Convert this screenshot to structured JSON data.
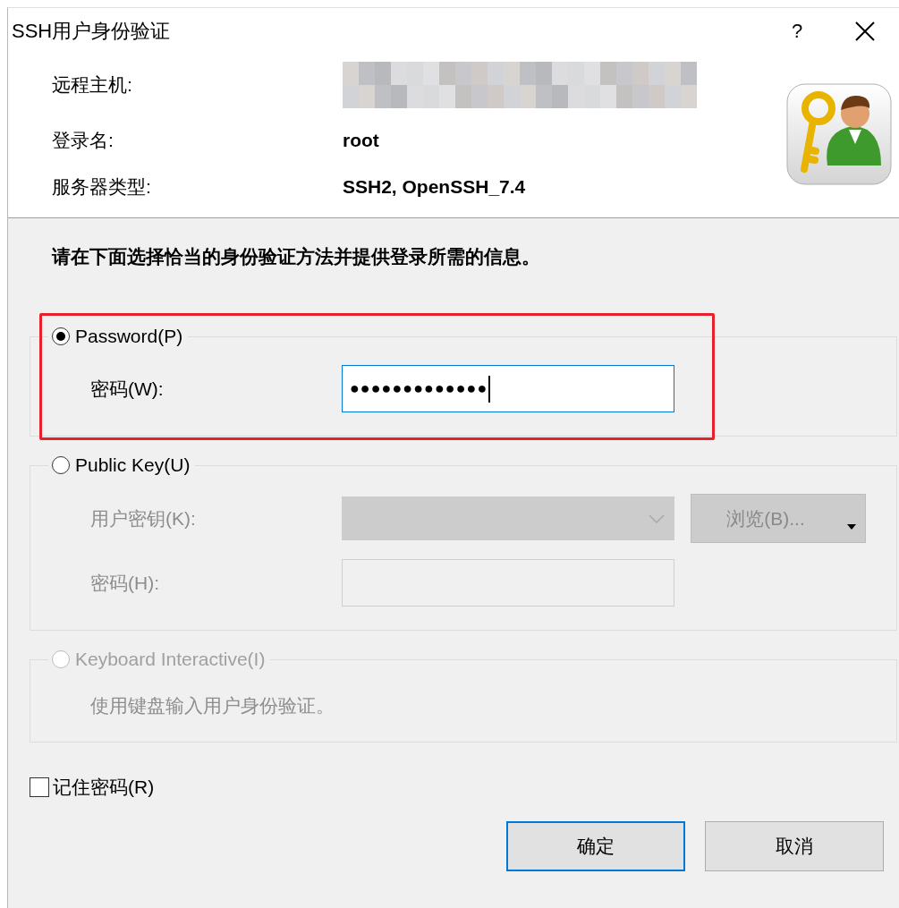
{
  "window": {
    "title": "SSH用户身份验证",
    "help": "?"
  },
  "info": [
    {
      "label": "远程主机:",
      "kind": "redacted"
    },
    {
      "label": "登录名:",
      "kind": "text",
      "value": "root"
    },
    {
      "label": "服务器类型:",
      "kind": "text",
      "value": "SSH2, OpenSSH_7.4"
    }
  ],
  "instruction": "请在下面选择恰当的身份验证方法并提供登录所需的信息。",
  "methods": [
    {
      "label": "Password(P)",
      "selected": true,
      "disabled": false,
      "highlighted": true,
      "fields": [
        {
          "kind": "text",
          "label": "密码(W):",
          "value": "●●●●●●●●●●●●●",
          "focused": true,
          "disabled": false
        }
      ]
    },
    {
      "label": "Public Key(U)",
      "selected": false,
      "disabled": false,
      "highlighted": false,
      "fields": [
        {
          "kind": "combo",
          "label": "用户密钥(K):",
          "disabled": true,
          "button": "浏览(B)..."
        },
        {
          "kind": "text",
          "label": "密码(H):",
          "disabled": true,
          "focused": false
        }
      ]
    },
    {
      "label": "Keyboard Interactive(I)",
      "selected": false,
      "disabled": true,
      "highlighted": false,
      "description": "使用键盘输入用户身份验证。"
    }
  ],
  "remember": {
    "label": "记住密码(R)",
    "checked": false
  },
  "buttons": [
    {
      "label": "确定",
      "default": true
    },
    {
      "label": "取消",
      "default": false
    }
  ]
}
